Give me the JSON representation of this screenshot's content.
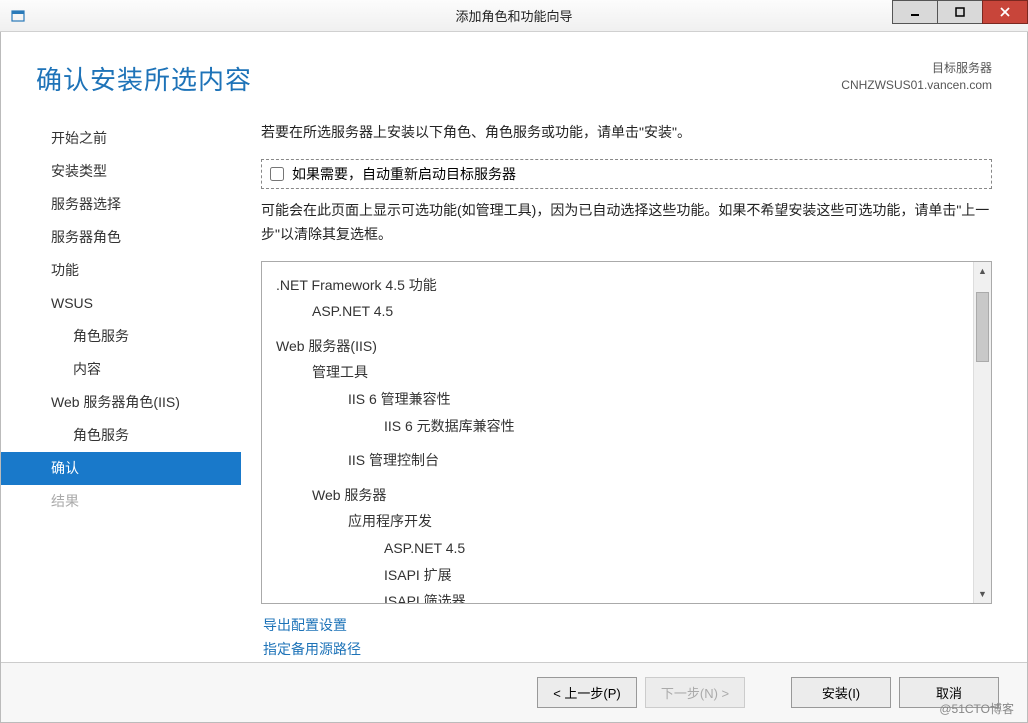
{
  "window": {
    "title": "添加角色和功能向导"
  },
  "header": {
    "heading": "确认安装所选内容",
    "target_label": "目标服务器",
    "target_server": "CNHZWSUS01.vancen.com"
  },
  "sidebar": {
    "items": [
      {
        "label": "开始之前",
        "indent": false,
        "state": "normal"
      },
      {
        "label": "安装类型",
        "indent": false,
        "state": "normal"
      },
      {
        "label": "服务器选择",
        "indent": false,
        "state": "normal"
      },
      {
        "label": "服务器角色",
        "indent": false,
        "state": "normal"
      },
      {
        "label": "功能",
        "indent": false,
        "state": "normal"
      },
      {
        "label": "WSUS",
        "indent": false,
        "state": "normal"
      },
      {
        "label": "角色服务",
        "indent": true,
        "state": "normal"
      },
      {
        "label": "内容",
        "indent": true,
        "state": "normal"
      },
      {
        "label": "Web 服务器角色(IIS)",
        "indent": false,
        "state": "normal"
      },
      {
        "label": "角色服务",
        "indent": true,
        "state": "normal"
      },
      {
        "label": "确认",
        "indent": false,
        "state": "selected"
      },
      {
        "label": "结果",
        "indent": false,
        "state": "disabled"
      }
    ]
  },
  "main": {
    "intro": "若要在所选服务器上安装以下角色、角色服务或功能，请单击\"安装\"。",
    "checkbox_label": "如果需要，自动重新启动目标服务器",
    "checkbox_checked": false,
    "note": "可能会在此页面上显示可选功能(如管理工具)，因为已自动选择这些功能。如果不希望安装这些可选功能，请单击\"上一步\"以清除其复选框。",
    "features": [
      {
        "text": ".NET Framework 4.5 功能",
        "level": 0
      },
      {
        "text": "ASP.NET 4.5",
        "level": 1
      },
      {
        "text": "Web 服务器(IIS)",
        "level": 0,
        "spaced": true
      },
      {
        "text": "管理工具",
        "level": 1
      },
      {
        "text": "IIS 6 管理兼容性",
        "level": 2
      },
      {
        "text": "IIS 6 元数据库兼容性",
        "level": 3
      },
      {
        "text": "IIS 管理控制台",
        "level": 2,
        "spaced": true
      },
      {
        "text": "Web 服务器",
        "level": 1,
        "spaced": true
      },
      {
        "text": "应用程序开发",
        "level": 2
      },
      {
        "text": "ASP.NET 4.5",
        "level": 3
      },
      {
        "text": "ISAPI 扩展",
        "level": 3
      },
      {
        "text": "ISAPI 筛选器",
        "level": 3
      }
    ],
    "links": {
      "export": "导出配置设置",
      "alt_source": "指定备用源路径"
    }
  },
  "buttons": {
    "prev": "< 上一步(P)",
    "next": "下一步(N) >",
    "install": "安装(I)",
    "cancel": "取消"
  },
  "watermark": "@51CTO博客"
}
